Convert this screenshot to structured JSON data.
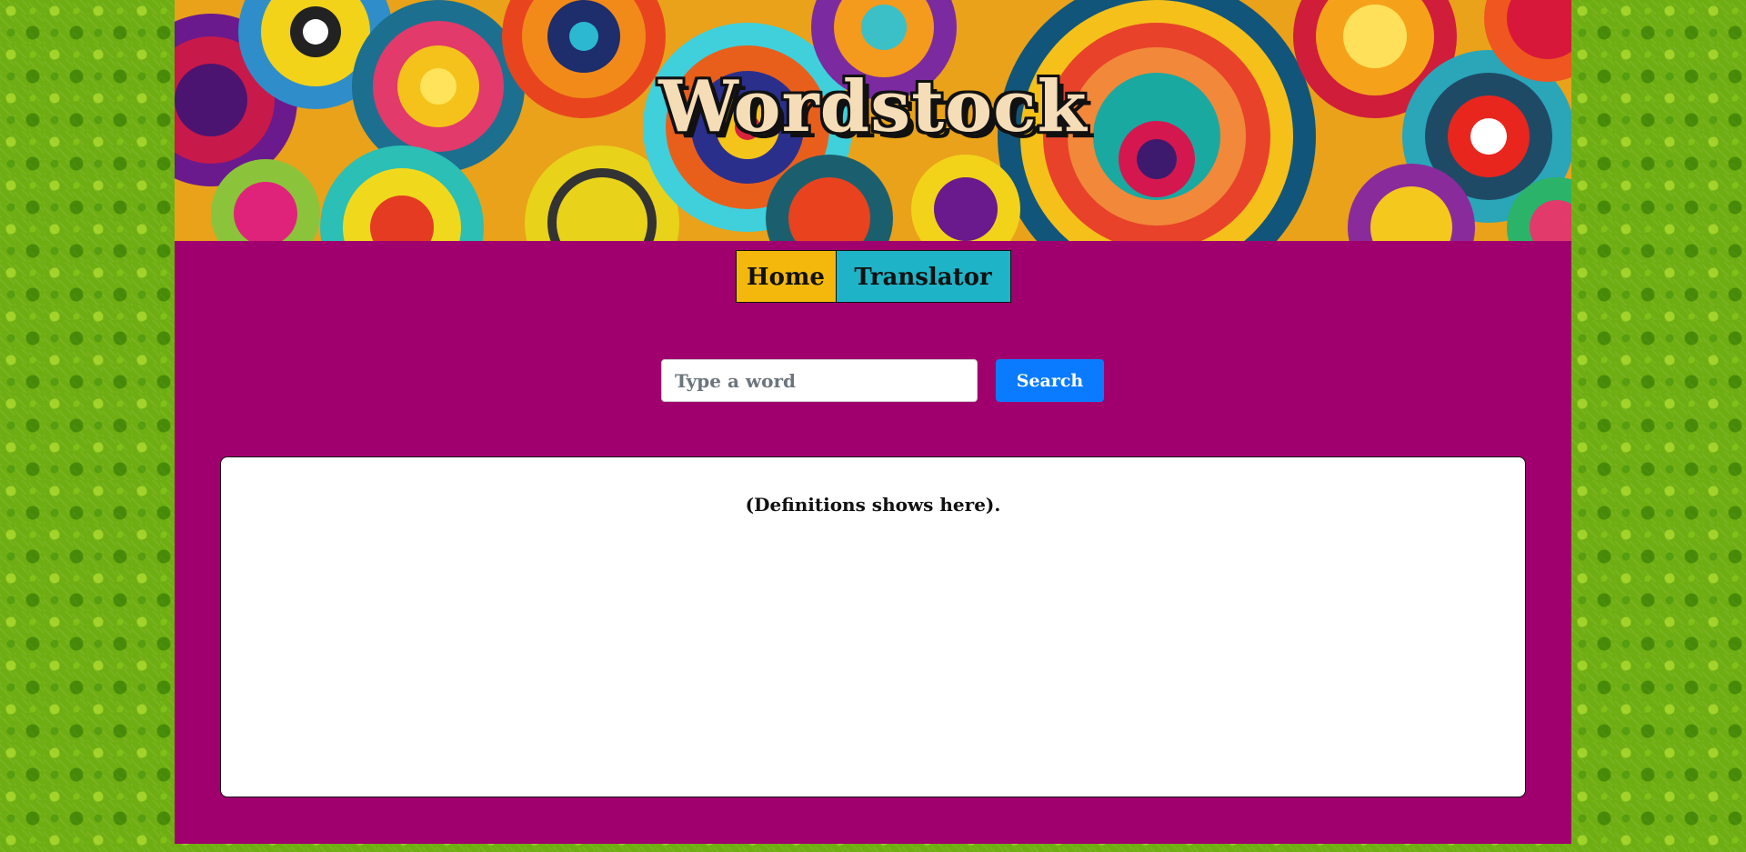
{
  "header": {
    "title": "Wordstock"
  },
  "nav": {
    "items": [
      {
        "label": "Home",
        "color": "#f4b70b"
      },
      {
        "label": "Translator",
        "color": "#1fb3c7"
      }
    ]
  },
  "search": {
    "placeholder": "Type a word",
    "value": "",
    "button_label": "Search"
  },
  "results": {
    "text": "(Definitions shows here)."
  },
  "colors": {
    "page_background": "#a0006e",
    "wallpaper": "#6fae12",
    "search_button": "#0a7bff"
  }
}
